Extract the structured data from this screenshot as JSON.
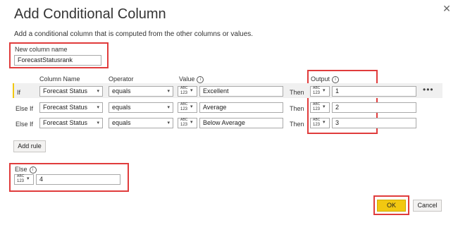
{
  "dialog": {
    "title": "Add Conditional Column",
    "subtitle": "Add a conditional column that is computed from the other columns or values.",
    "close_icon": "close-icon"
  },
  "new_column": {
    "label": "New column name",
    "value": "ForecastStatusrank"
  },
  "headers": {
    "column_name": "Column Name",
    "operator": "Operator",
    "value": "Value",
    "output": "Output"
  },
  "type_button": {
    "abc": "ABC",
    "n123": "123"
  },
  "rules": [
    {
      "label": "If",
      "column": "Forecast Status",
      "operator": "equals",
      "value": "Excellent",
      "then": "Then",
      "output": "1"
    },
    {
      "label": "Else If",
      "column": "Forecast Status",
      "operator": "equals",
      "value": "Average",
      "then": "Then",
      "output": "2"
    },
    {
      "label": "Else If",
      "column": "Forecast Status",
      "operator": "equals",
      "value": "Below Average",
      "then": "Then",
      "output": "3"
    }
  ],
  "more_options": "•••",
  "add_rule_label": "Add rule",
  "else": {
    "label": "Else",
    "value": "4"
  },
  "buttons": {
    "ok": "OK",
    "cancel": "Cancel"
  },
  "colors": {
    "highlight_border": "#e03c3c",
    "ok_button": "#f2c811",
    "active_row_marker": "#f2c811"
  }
}
